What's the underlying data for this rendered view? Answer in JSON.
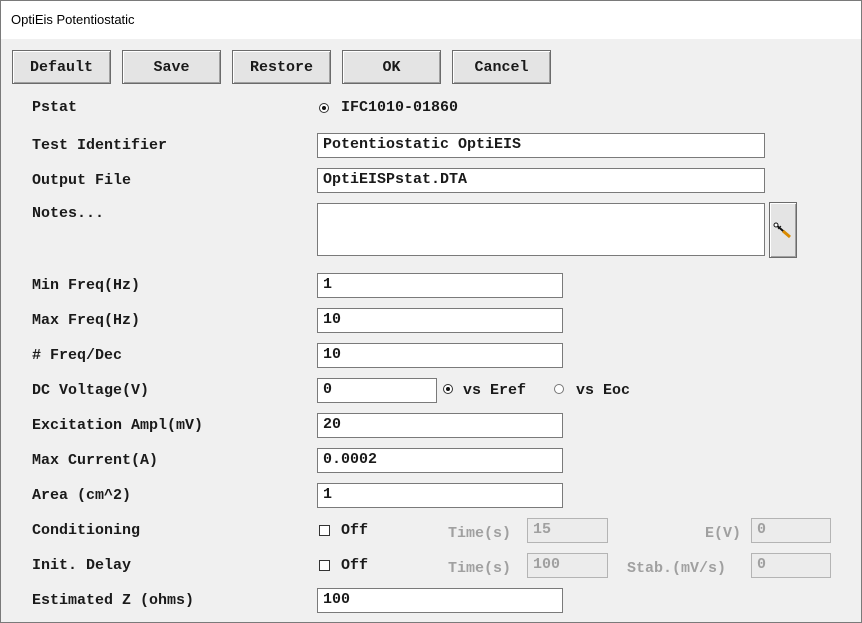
{
  "window": {
    "title": "OptiEis Potentiostatic"
  },
  "toolbar": {
    "default_label": "Default",
    "save_label": "Save",
    "restore_label": "Restore",
    "ok_label": "OK",
    "cancel_label": "Cancel"
  },
  "form": {
    "pstat": {
      "label": "Pstat",
      "value": "IFC1010-01860"
    },
    "test_identifier": {
      "label": "Test Identifier",
      "value": "Potentiostatic OptiEIS"
    },
    "output_file": {
      "label": "Output File",
      "value": "OptiEISPstat.DTA"
    },
    "notes": {
      "label": "Notes...",
      "value": ""
    },
    "min_freq": {
      "label": "Min Freq(Hz)",
      "value": "1"
    },
    "max_freq": {
      "label": "Max Freq(Hz)",
      "value": "10"
    },
    "freq_dec": {
      "label": "# Freq/Dec",
      "value": "10"
    },
    "dc_voltage": {
      "label": "DC Voltage(V)",
      "value": "0",
      "option_eref": "vs Eref",
      "option_eoc": "vs Eoc",
      "selected": "vs Eref"
    },
    "excitation": {
      "label": "Excitation Ampl(mV)",
      "value": "20"
    },
    "max_current": {
      "label": "Max Current(A)",
      "value": "0.0002"
    },
    "area": {
      "label": "Area (cm^2)",
      "value": "1"
    },
    "conditioning": {
      "label": "Conditioning",
      "check_label": "Off",
      "checked": false,
      "time_label": "Time(s)",
      "time_value": "15",
      "e_label": "E(V)",
      "e_value": "0"
    },
    "init_delay": {
      "label": "Init. Delay",
      "check_label": "Off",
      "checked": false,
      "time_label": "Time(s)",
      "time_value": "100",
      "stab_label": "Stab.(mV/s)",
      "stab_value": "0"
    },
    "estimated_z": {
      "label": "Estimated Z (ohms)",
      "value": "100"
    }
  },
  "icons": {
    "notes_edit": "pencil-edit-icon"
  }
}
